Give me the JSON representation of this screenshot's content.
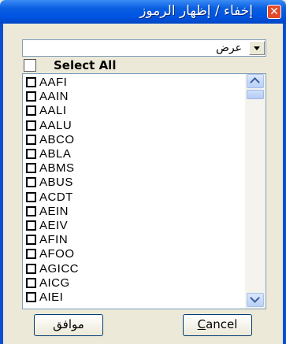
{
  "window": {
    "title": "إخفاء / إظهار الرموز",
    "close_glyph": "✕"
  },
  "dropdown": {
    "value": "عرض"
  },
  "select_all": {
    "label": "Select All",
    "checked": false
  },
  "list": {
    "items": [
      {
        "label": "AAFI"
      },
      {
        "label": "AAIN"
      },
      {
        "label": "AALI"
      },
      {
        "label": "AALU"
      },
      {
        "label": "ABCO"
      },
      {
        "label": "ABLA"
      },
      {
        "label": "ABMS"
      },
      {
        "label": "ABUS"
      },
      {
        "label": "ACDT"
      },
      {
        "label": "AEIN"
      },
      {
        "label": "AEIV"
      },
      {
        "label": "AFIN"
      },
      {
        "label": "AFOO"
      },
      {
        "label": "AGICC"
      },
      {
        "label": "AICG"
      },
      {
        "label": "AIEI"
      }
    ]
  },
  "buttons": {
    "ok_label": "موافق",
    "cancel_first": "C",
    "cancel_rest": "ancel"
  }
}
